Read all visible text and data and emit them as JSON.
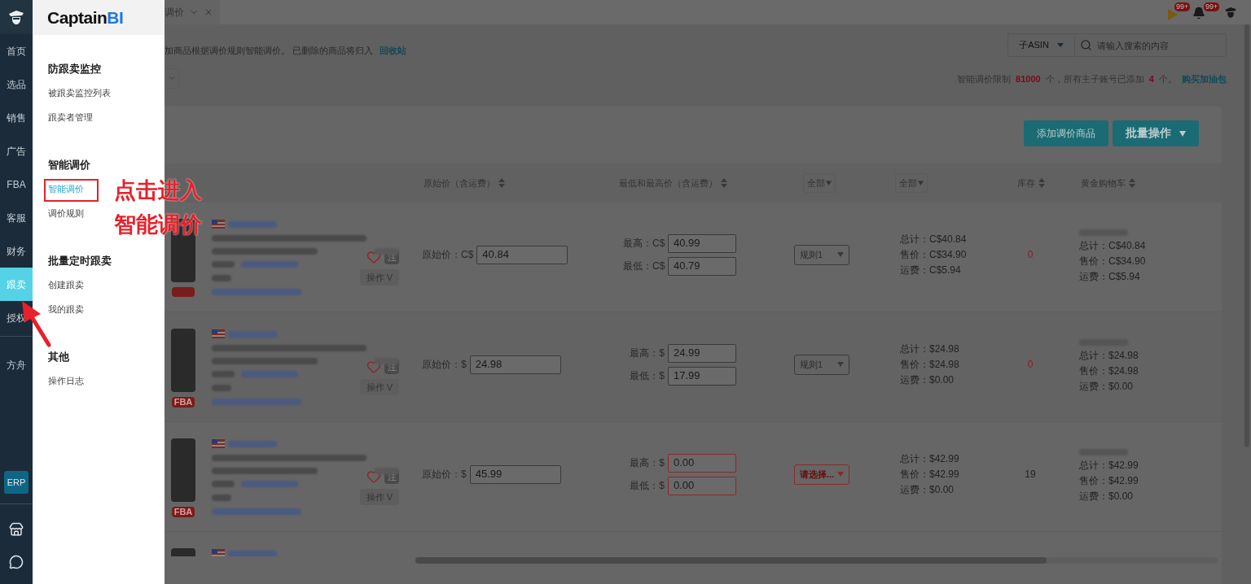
{
  "sidebar": {
    "items": [
      {
        "label": "首页",
        "selected": false
      },
      {
        "label": "选品",
        "selected": false
      },
      {
        "label": "销售",
        "selected": false
      },
      {
        "label": "广告",
        "selected": false
      },
      {
        "label": "FBA",
        "selected": false
      },
      {
        "label": "客服",
        "selected": false
      },
      {
        "label": "财务",
        "selected": false
      },
      {
        "label": "跟卖",
        "selected": true
      },
      {
        "label": "授权",
        "selected": false
      },
      {
        "label": "方舟",
        "selected": false
      }
    ],
    "erp": "ERP"
  },
  "flyout": {
    "logo": {
      "text": "Captain",
      "accent": "BI"
    },
    "groups": [
      {
        "title": "防跟卖监控",
        "items": [
          {
            "label": "被跟卖监控列表",
            "selected": false
          },
          {
            "label": "跟卖者管理",
            "selected": false
          }
        ]
      },
      {
        "title": "智能调价",
        "items": [
          {
            "label": "智能调价",
            "selected": true
          },
          {
            "label": "调价规则",
            "selected": false
          }
        ]
      },
      {
        "title": "批量定时跟卖",
        "items": [
          {
            "label": "创建跟卖",
            "selected": false
          },
          {
            "label": "我的跟卖",
            "selected": false
          }
        ]
      },
      {
        "title": "其他",
        "items": [
          {
            "label": "操作日志",
            "selected": false
          }
        ]
      }
    ]
  },
  "annotation": {
    "lines": [
      "点击进入",
      "智能调价"
    ]
  },
  "tab": {
    "label": "调价"
  },
  "header": {
    "badges": [
      "99+",
      "99+"
    ]
  },
  "notice": {
    "text": "加商品根据调价规则智能调价。 已删除的商品将归入",
    "link": "回收站"
  },
  "search": {
    "scope": "子ASIN",
    "placeholder": "请输入搜索的内容"
  },
  "quota": {
    "segments": [
      {
        "text": "智能调价限制 ",
        "highlight": false
      },
      {
        "text": "81000",
        "highlight": true
      },
      {
        "text": " 个，所有主子账号已添加 ",
        "highlight": false
      },
      {
        "text": "4",
        "highlight": true
      },
      {
        "text": " 个。",
        "highlight": false
      }
    ],
    "link": "购买加油包"
  },
  "buttons": [
    {
      "label": "添加调价商品",
      "kind": "plain"
    },
    {
      "label": "批量操作",
      "kind": "dropdown"
    }
  ],
  "table": {
    "columns": [
      {
        "label": "原始价（含运费）",
        "kind": "sort"
      },
      {
        "label": "最低和最高价（含运费）",
        "kind": "sort"
      },
      {
        "label": "全部",
        "kind": "filter"
      },
      {
        "label": "全部",
        "kind": "filter"
      },
      {
        "label": "库存",
        "kind": "sort"
      },
      {
        "label": "黄金购物车",
        "kind": "sort"
      }
    ],
    "rows": [
      {
        "badge": null,
        "note": "注",
        "action": "操作 V",
        "original_price": {
          "label": "原始价：",
          "currency": "C$",
          "value": "40.84"
        },
        "max": {
          "label": "最高：",
          "currency": "C$",
          "value": "40.99",
          "invalid": false
        },
        "min": {
          "label": "最低：",
          "currency": "C$",
          "value": "40.79",
          "invalid": false
        },
        "rule": {
          "label": "规则1",
          "invalid": false
        },
        "totals": [
          "总计：C$40.84",
          "售价：C$34.90",
          "运费：C$5.94"
        ],
        "stock": {
          "value": "0",
          "alert": true
        },
        "buybox": [
          "总计：C$40.84",
          "售价：C$34.90",
          "运费：C$5.94"
        ]
      },
      {
        "badge": "FBA",
        "note": "注",
        "action": "操作 V",
        "original_price": {
          "label": "原始价：",
          "currency": "$",
          "value": "24.98"
        },
        "max": {
          "label": "最高：",
          "currency": "$",
          "value": "24.99",
          "invalid": false
        },
        "min": {
          "label": "最低：",
          "currency": "$",
          "value": "17.99",
          "invalid": false
        },
        "rule": {
          "label": "规则1",
          "invalid": false
        },
        "totals": [
          "总计：$24.98",
          "售价：$24.98",
          "运费：$0.00"
        ],
        "stock": {
          "value": "0",
          "alert": true
        },
        "buybox": [
          "总计：$24.98",
          "售价：$24.98",
          "运费：$0.00"
        ]
      },
      {
        "badge": "FBA",
        "note": "注",
        "action": "操作 V",
        "original_price": {
          "label": "原始价：",
          "currency": "$",
          "value": "45.99"
        },
        "max": {
          "label": "最高：",
          "currency": "$",
          "value": "0.00",
          "invalid": true
        },
        "min": {
          "label": "最低：",
          "currency": "$",
          "value": "0.00",
          "invalid": true
        },
        "rule": {
          "label": "请选择...",
          "invalid": true
        },
        "totals": [
          "总计：$42.99",
          "售价：$42.99",
          "运费：$0.00"
        ],
        "stock": {
          "value": "19",
          "alert": false
        },
        "buybox": [
          "总计：$42.99",
          "售价：$42.99",
          "运费：$0.00"
        ]
      }
    ]
  }
}
